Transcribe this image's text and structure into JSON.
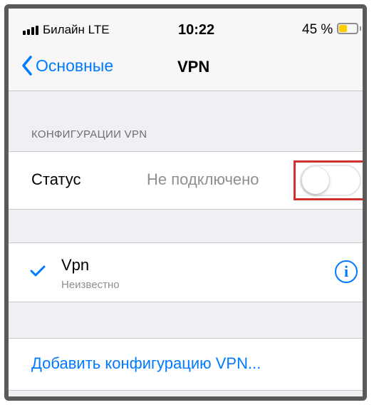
{
  "status_bar": {
    "carrier": "Билайн  LTE",
    "time": "10:22",
    "battery_percent": "45 %",
    "battery_level": 0.45,
    "battery_color": "#ffcc00"
  },
  "nav": {
    "back_label": "Основные",
    "title": "VPN"
  },
  "section": {
    "header": "КОНФИГУРАЦИИ VPN"
  },
  "status_row": {
    "label": "Статус",
    "value": "Не подключено",
    "toggle_on": false
  },
  "vpn_item": {
    "name": "Vpn",
    "subtitle": "Неизвестно",
    "selected": true
  },
  "add_config": {
    "label": "Добавить конфигурацию VPN..."
  },
  "colors": {
    "accent": "#007aff",
    "highlight_box": "#d0312d",
    "background": "#efeff4"
  },
  "icons": {
    "signal": "signal-bars-icon",
    "battery": "battery-icon",
    "back": "chevron-left-icon",
    "check": "checkmark-icon",
    "info": "info-icon"
  }
}
